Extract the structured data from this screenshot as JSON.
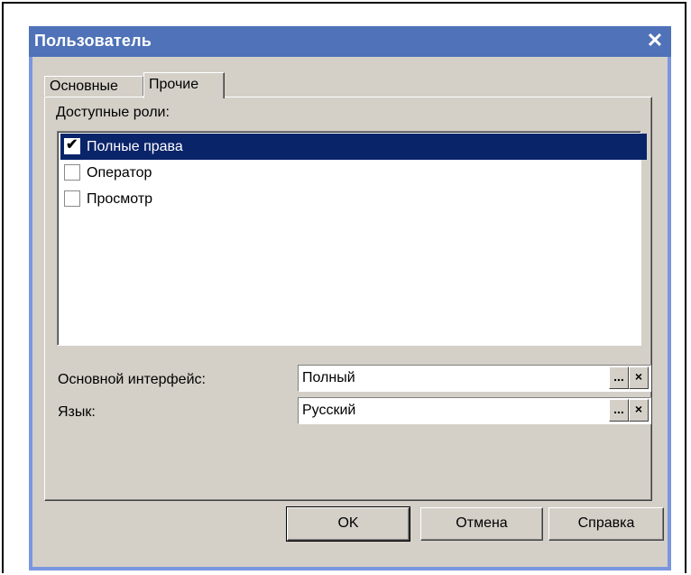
{
  "window": {
    "title": "Пользователь",
    "close_glyph": "✕"
  },
  "tabs": [
    {
      "label": "Основные",
      "active": false
    },
    {
      "label": "Прочие",
      "active": true
    }
  ],
  "roles": {
    "label": "Доступные роли:",
    "items": [
      {
        "label": "Полные права",
        "checked": true,
        "selected": true
      },
      {
        "label": "Оператор",
        "checked": false,
        "selected": false
      },
      {
        "label": "Просмотр",
        "checked": false,
        "selected": false
      }
    ]
  },
  "fields": {
    "interface": {
      "label": "Основной интерфейс:",
      "value": "Полный"
    },
    "language": {
      "label": "Язык:",
      "value": "Русский"
    },
    "select_glyph": "...",
    "clear_glyph": "×"
  },
  "buttons": {
    "ok": "OK",
    "cancel": "Отмена",
    "help": "Справка"
  },
  "colors": {
    "titlebar": "#4f72b8",
    "selection": "#0a246a",
    "face": "#d4d0c8"
  },
  "icons": {
    "close": "close-icon",
    "check": "checkmark-icon",
    "ellipsis": "ellipsis-icon",
    "clear": "clear-icon"
  }
}
